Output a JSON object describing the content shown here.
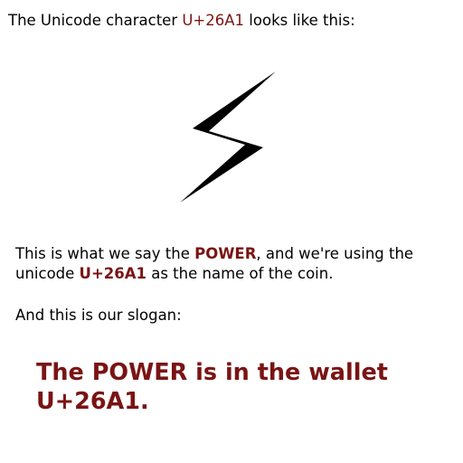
{
  "heading": {
    "prefix": "The Unicode character ",
    "code": "U+26A1",
    "suffix": " looks like this:"
  },
  "symbol": {
    "icon": "lightning-bolt-icon",
    "color": "#000000"
  },
  "description": {
    "line1_prefix": "This is what we say the ",
    "line1_power": "POWER",
    "line1_suffix": ", and we're using the",
    "line2_prefix": "unicode ",
    "line2_code": "U+26A1",
    "line2_suffix": " as the name of the coin."
  },
  "slogan_intro": "And this is our slogan:",
  "slogan": {
    "line1": "The POWER is in the wallet",
    "line2": "U+26A1."
  },
  "colors": {
    "accent": "#7a1414",
    "text": "#000000",
    "background": "#ffffff"
  }
}
